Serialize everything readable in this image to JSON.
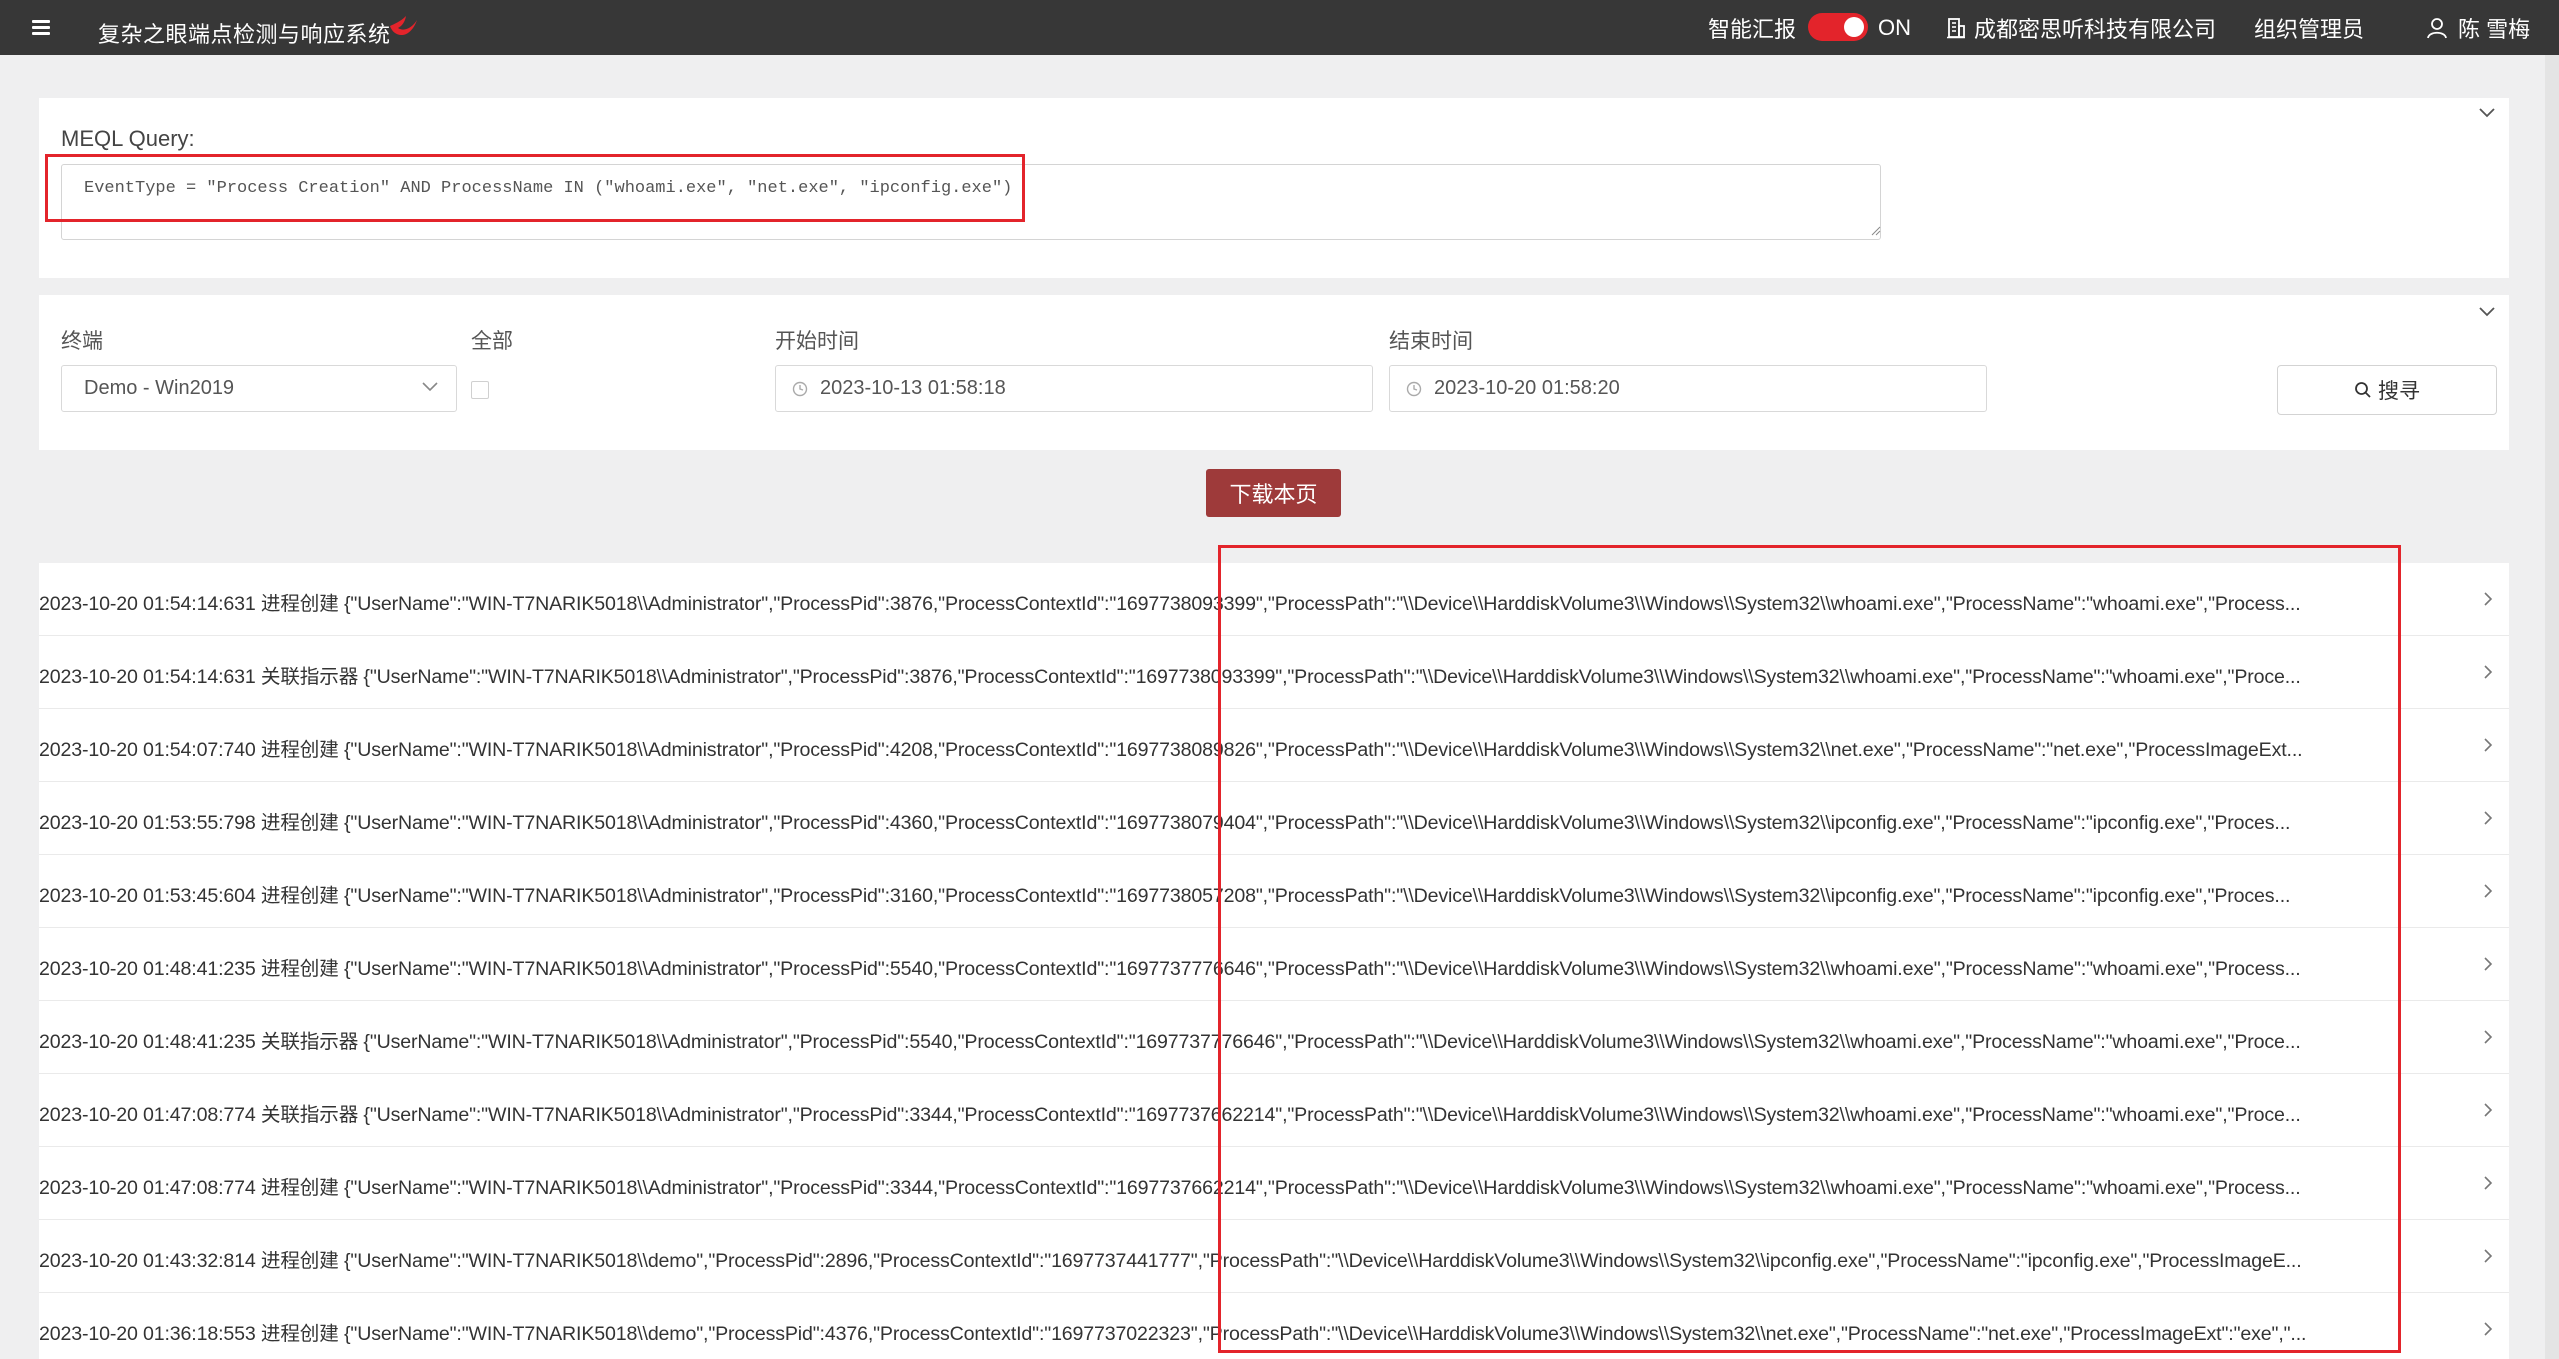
{
  "app": {
    "title": "复杂之眼端点检测与响应系统",
    "smart_report_label": "智能汇报",
    "toggle_state": "ON",
    "company": "成都密思听科技有限公司",
    "role": "组织管理员",
    "user": "陈 雪梅",
    "accent_color": "#e3242b"
  },
  "query": {
    "label": "MEQL Query:",
    "value": "EventType = \"Process Creation\" AND ProcessName IN (\"whoami.exe\", \"net.exe\", \"ipconfig.exe\")"
  },
  "filters": {
    "terminal_label": "终端",
    "terminal_value": "Demo - Win2019",
    "all_label": "全部",
    "start_label": "开始时间",
    "start_value": "2023-10-13 01:58:18",
    "end_label": "结束时间",
    "end_value": "2023-10-20 01:58:20",
    "search_label": "搜寻"
  },
  "download_label": "下载本页",
  "results": [
    "2023-10-20 01:54:14:631 进程创建 {\"UserName\":\"WIN-T7NARIK5018\\\\Administrator\",\"ProcessPid\":3876,\"ProcessContextId\":\"1697738093399\",\"ProcessPath\":\"\\\\Device\\\\HarddiskVolume3\\\\Windows\\\\System32\\\\whoami.exe\",\"ProcessName\":\"whoami.exe\",\"Process...",
    "2023-10-20 01:54:14:631 关联指示器 {\"UserName\":\"WIN-T7NARIK5018\\\\Administrator\",\"ProcessPid\":3876,\"ProcessContextId\":\"1697738093399\",\"ProcessPath\":\"\\\\Device\\\\HarddiskVolume3\\\\Windows\\\\System32\\\\whoami.exe\",\"ProcessName\":\"whoami.exe\",\"Proce...",
    "2023-10-20 01:54:07:740 进程创建 {\"UserName\":\"WIN-T7NARIK5018\\\\Administrator\",\"ProcessPid\":4208,\"ProcessContextId\":\"1697738089826\",\"ProcessPath\":\"\\\\Device\\\\HarddiskVolume3\\\\Windows\\\\System32\\\\net.exe\",\"ProcessName\":\"net.exe\",\"ProcessImageExt...",
    "2023-10-20 01:53:55:798 进程创建 {\"UserName\":\"WIN-T7NARIK5018\\\\Administrator\",\"ProcessPid\":4360,\"ProcessContextId\":\"1697738079404\",\"ProcessPath\":\"\\\\Device\\\\HarddiskVolume3\\\\Windows\\\\System32\\\\ipconfig.exe\",\"ProcessName\":\"ipconfig.exe\",\"Proces...",
    "2023-10-20 01:53:45:604 进程创建 {\"UserName\":\"WIN-T7NARIK5018\\\\Administrator\",\"ProcessPid\":3160,\"ProcessContextId\":\"1697738057208\",\"ProcessPath\":\"\\\\Device\\\\HarddiskVolume3\\\\Windows\\\\System32\\\\ipconfig.exe\",\"ProcessName\":\"ipconfig.exe\",\"Proces...",
    "2023-10-20 01:48:41:235 进程创建 {\"UserName\":\"WIN-T7NARIK5018\\\\Administrator\",\"ProcessPid\":5540,\"ProcessContextId\":\"1697737776646\",\"ProcessPath\":\"\\\\Device\\\\HarddiskVolume3\\\\Windows\\\\System32\\\\whoami.exe\",\"ProcessName\":\"whoami.exe\",\"Process...",
    "2023-10-20 01:48:41:235 关联指示器 {\"UserName\":\"WIN-T7NARIK5018\\\\Administrator\",\"ProcessPid\":5540,\"ProcessContextId\":\"1697737776646\",\"ProcessPath\":\"\\\\Device\\\\HarddiskVolume3\\\\Windows\\\\System32\\\\whoami.exe\",\"ProcessName\":\"whoami.exe\",\"Proce...",
    "2023-10-20 01:47:08:774 关联指示器 {\"UserName\":\"WIN-T7NARIK5018\\\\Administrator\",\"ProcessPid\":3344,\"ProcessContextId\":\"1697737662214\",\"ProcessPath\":\"\\\\Device\\\\HarddiskVolume3\\\\Windows\\\\System32\\\\whoami.exe\",\"ProcessName\":\"whoami.exe\",\"Proce...",
    "2023-10-20 01:47:08:774 进程创建 {\"UserName\":\"WIN-T7NARIK5018\\\\Administrator\",\"ProcessPid\":3344,\"ProcessContextId\":\"1697737662214\",\"ProcessPath\":\"\\\\Device\\\\HarddiskVolume3\\\\Windows\\\\System32\\\\whoami.exe\",\"ProcessName\":\"whoami.exe\",\"Process...",
    "2023-10-20 01:43:32:814 进程创建 {\"UserName\":\"WIN-T7NARIK5018\\\\demo\",\"ProcessPid\":2896,\"ProcessContextId\":\"1697737441777\",\"ProcessPath\":\"\\\\Device\\\\HarddiskVolume3\\\\Windows\\\\System32\\\\ipconfig.exe\",\"ProcessName\":\"ipconfig.exe\",\"ProcessImageE...",
    "2023-10-20 01:36:18:553 进程创建 {\"UserName\":\"WIN-T7NARIK5018\\\\demo\",\"ProcessPid\":4376,\"ProcessContextId\":\"1697737022323\",\"ProcessPath\":\"\\\\Device\\\\HarddiskVolume3\\\\Windows\\\\System32\\\\net.exe\",\"ProcessName\":\"net.exe\",\"ProcessImageExt\":\"exe\",\"..."
  ]
}
